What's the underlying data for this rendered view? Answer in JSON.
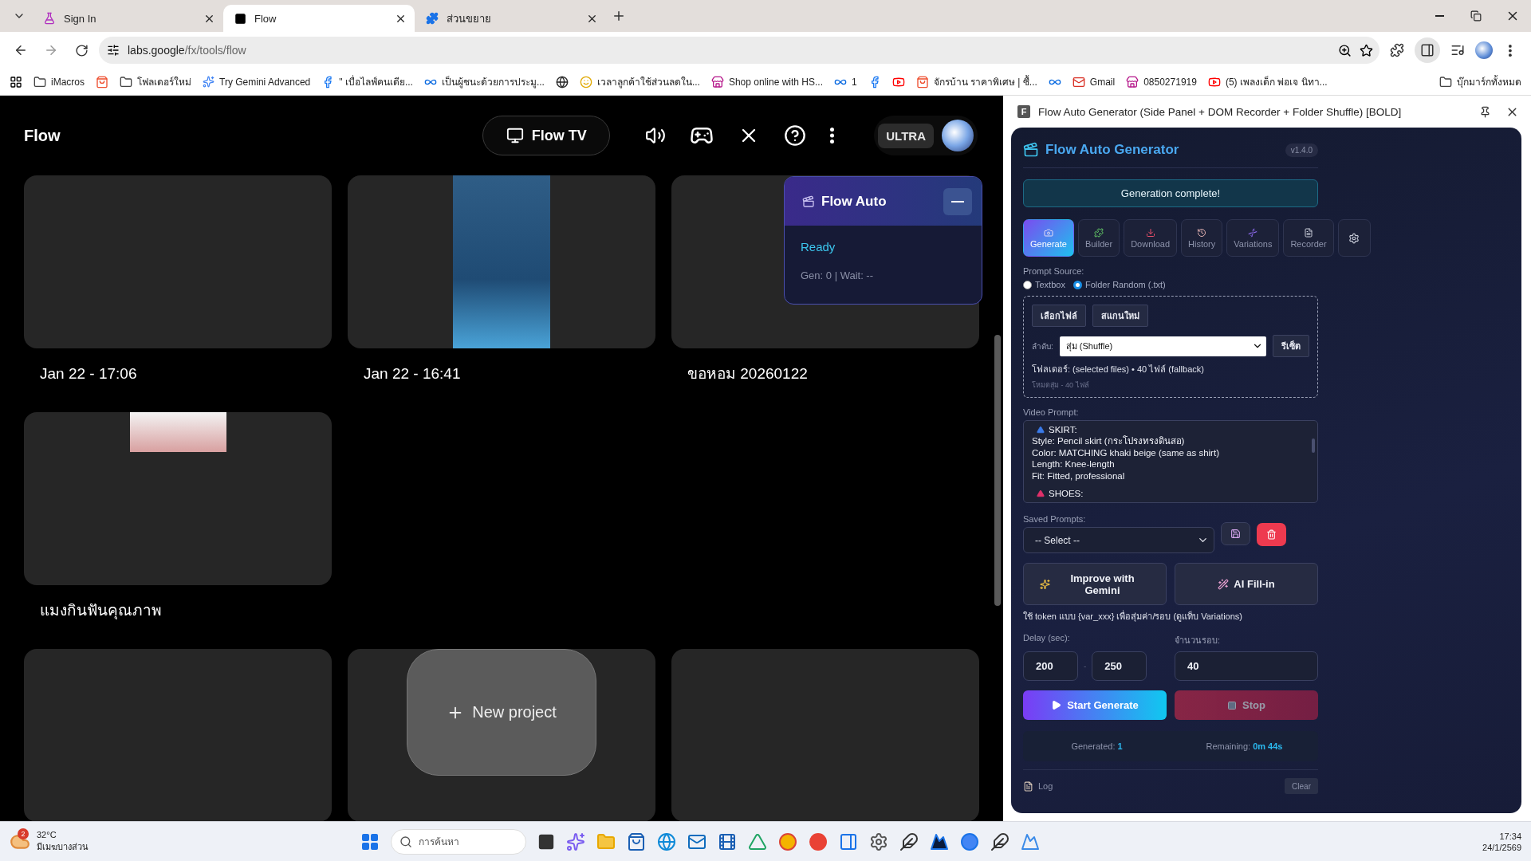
{
  "browser": {
    "tabs": [
      {
        "title": "Sign In",
        "kind": "flask",
        "selected": false
      },
      {
        "title": "Flow",
        "kind": "block",
        "selected": true
      },
      {
        "title": "ส่วนขยาย",
        "kind": "puzzle",
        "selected": false
      }
    ],
    "url": {
      "host": "labs.google",
      "path": "/fx/tools/flow"
    },
    "bookmarks": [
      {
        "kind": "folder",
        "label": "iMacros"
      },
      {
        "kind": "bag"
      },
      {
        "kind": "folder",
        "label": "โฟลเดอร์ใหม่"
      },
      {
        "kind": "sparkle",
        "label": "Try Gemini Advanced"
      },
      {
        "kind": "facebook",
        "label": "\" เบื่อไลฟ์คนเดีย..."
      },
      {
        "kind": "infinity",
        "label": "เป็นผู้ชนะด้วยการประมู..."
      },
      {
        "kind": "globe"
      },
      {
        "kind": "smile",
        "label": "เวลาลูกค้าใช้ส่วนลดใน..."
      },
      {
        "kind": "store",
        "label": "Shop online with HS..."
      },
      {
        "kind": "infinity",
        "label": "1"
      },
      {
        "kind": "facebook"
      },
      {
        "kind": "youtube"
      },
      {
        "kind": "bag",
        "label": "จักรบ้าน ราคาพิเศษ | ซื้..."
      },
      {
        "kind": "infinity"
      },
      {
        "kind": "mail",
        "label": "Gmail"
      },
      {
        "kind": "store",
        "label": "0850271919"
      },
      {
        "kind": "youtube",
        "label": "(5) เพลงเด็ก พ่อเจ นิทา..."
      }
    ],
    "all_bookmarks": "บุ๊กมาร์กทั้งหมด"
  },
  "flow": {
    "logo": "Flow",
    "tv_button": "Flow TV",
    "plan": "ULTRA",
    "project_rows": [
      [
        {
          "title": "Jan 22 - 17:06",
          "kind": "empty"
        },
        {
          "title": "Jan 22 - 16:41",
          "kind": "tall"
        },
        {
          "title": "ขอหอม 20260122",
          "kind": "empty"
        }
      ],
      [
        {
          "title": "แมงกินฟันคุณภาพ",
          "kind": "strip"
        }
      ],
      [
        {
          "kind": "empty"
        },
        {
          "kind": "empty"
        },
        {
          "kind": "empty"
        }
      ]
    ],
    "new_project": "New project",
    "overlay": {
      "title": "Flow Auto",
      "status": "Ready",
      "stats": "Gen: 0 | Wait: --"
    }
  },
  "panel": {
    "favicon": "F",
    "window_title": "Flow Auto Generator (Side Panel + DOM Recorder + Folder Shuffle) [BOLD]",
    "title": "Flow Auto Generator",
    "version": "v1.4.0",
    "banner": "Generation complete!",
    "tabs": [
      {
        "label": "Generate",
        "kind": "camera",
        "selected": true
      },
      {
        "label": "Builder",
        "kind": "puzzle",
        "selected": false
      },
      {
        "label": "Download",
        "kind": "download",
        "selected": false
      },
      {
        "label": "History",
        "kind": "history",
        "selected": false
      },
      {
        "label": "Variations",
        "kind": "dna",
        "selected": false
      },
      {
        "label": "Recorder",
        "kind": "file",
        "selected": false
      },
      {
        "kind": "settings",
        "selected": false
      }
    ],
    "prompt_source": {
      "label": "Prompt Source:",
      "options": [
        {
          "label": "Textbox",
          "selected": false
        },
        {
          "label": "Folder Random (.txt)",
          "selected": true
        }
      ]
    },
    "folder": {
      "buttons": [
        "เลือกไฟล์",
        "สแกนใหม่"
      ],
      "order_label": "ลำดับ:",
      "order_value": "สุ่ม (Shuffle)",
      "reset": "รีเซ็ต",
      "info": "โฟลเดอร์: (selected files) • 40 ไฟล์ (fallback)",
      "mode": "โหมดสุ่ม - 40 ไฟล์"
    },
    "video_prompt": {
      "label": "Video Prompt:",
      "lines": [
        {
          "text": "SKIRT:",
          "kind": "heading"
        },
        {
          "text": "Style: Pencil skirt (กระโปรงทรงดินสอ)",
          "kind": "plain"
        },
        {
          "text": "Color: MATCHING khaki beige (same as shirt)",
          "kind": "plain"
        },
        {
          "text": "Length: Knee-length",
          "kind": "plain"
        },
        {
          "text": "Fit: Fitted, professional",
          "kind": "plain"
        },
        {
          "text": "SHOES:",
          "kind": "heading"
        }
      ]
    },
    "saved": {
      "label": "Saved Prompts:",
      "value": "-- Select --"
    },
    "ai_buttons": [
      {
        "label": "Improve with Gemini",
        "kind": "sparkle"
      },
      {
        "label": "AI Fill-in",
        "kind": "wand"
      }
    ],
    "hint": "ใช้ token แบบ {var_xxx} เพื่อสุ่มค่า/รอบ (ดูแท็บ Variations)",
    "delay": {
      "label": "Delay (sec):",
      "min": "200",
      "separator": "-",
      "max": "250"
    },
    "rounds": {
      "label": "จำนวนรอบ:",
      "value": "40"
    },
    "start": {
      "label": "Start Generate",
      "disabled": false
    },
    "stop": {
      "label": "Stop",
      "disabled": true
    },
    "stats": [
      {
        "label": "Generated:",
        "value": "1"
      },
      {
        "label": "Remaining:",
        "value": "0m 44s"
      }
    ],
    "log": {
      "label": "Log",
      "clear": "Clear"
    }
  },
  "taskbar": {
    "weather": {
      "badge": "2",
      "temp": "32°C",
      "condition": "มีเมฆบางส่วน"
    },
    "search_placeholder": "การค้นหา",
    "time": "17:34",
    "date": "24/1/2569"
  }
}
